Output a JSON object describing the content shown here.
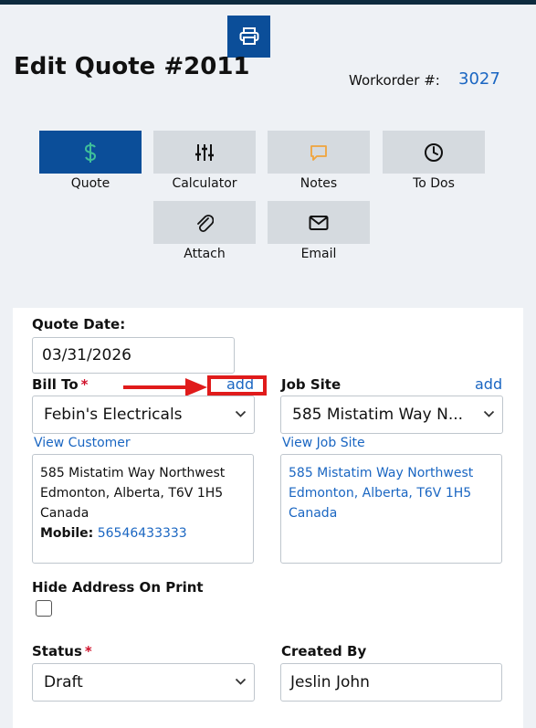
{
  "header": {
    "title": "Edit Quote #2011",
    "workorder_label": "Workorder #:",
    "workorder_value": "3027",
    "print_icon": "printer-icon"
  },
  "tabs": [
    {
      "label": "Quote",
      "icon": "dollar-icon",
      "active": true
    },
    {
      "label": "Calculator",
      "icon": "sliders-icon",
      "active": false
    },
    {
      "label": "Notes",
      "icon": "comment-icon",
      "active": false
    },
    {
      "label": "To Dos",
      "icon": "clock-icon",
      "active": false
    },
    {
      "label": "Attach",
      "icon": "paperclip-icon",
      "active": false
    },
    {
      "label": "Email",
      "icon": "envelope-icon",
      "active": false
    }
  ],
  "form": {
    "quote_date_label": "Quote Date:",
    "quote_date_value": "03/31/2026",
    "bill_to_label": "Bill To",
    "bill_to_required": "*",
    "bill_to_add": "add",
    "bill_to_value": "Febin's Electricals",
    "view_customer": "View Customer",
    "bill_address": {
      "line1": "585 Mistatim Way Northwest",
      "line2": "Edmonton, Alberta, T6V 1H5",
      "line3": "Canada",
      "mobile_label": "Mobile:",
      "mobile_value": "56546433333"
    },
    "job_site_label": "Job Site",
    "job_site_add": "add",
    "job_site_value": "585 Mistatim Way N...",
    "view_job_site": "View Job Site",
    "job_address": {
      "line1": "585 Mistatim Way Northwest",
      "line2": "Edmonton, Alberta, T6V 1H5",
      "line3": "Canada"
    },
    "hide_address_label": "Hide Address On Print",
    "hide_address_checked": false,
    "status_label": "Status",
    "status_required": "*",
    "status_value": "Draft",
    "created_by_label": "Created By",
    "created_by_value": "Jeslin John"
  },
  "colors": {
    "primary": "#0b4e99",
    "link": "#1a66c2",
    "tab_bg": "#d5dadf",
    "dollar_icon": "#3fbf9a",
    "notes_icon": "#f0a43c",
    "required": "#d0112b",
    "annotation": "#e01b1b"
  }
}
